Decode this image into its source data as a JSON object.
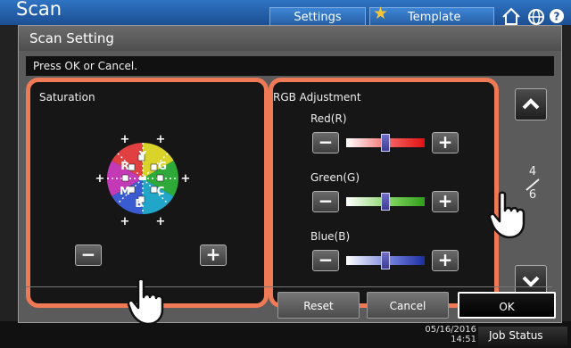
{
  "app": {
    "title": "Scan",
    "settings_label": "Settings",
    "template_label": "Template",
    "datetime_date": "05/16/2016",
    "datetime_time": "14:51",
    "job_status_label": "Job Status"
  },
  "dialog": {
    "title": "Scan Setting",
    "message": "Press OK or Cancel.",
    "saturation_label": "Saturation",
    "wheel_letters": [
      "Y",
      "R",
      "G",
      "M",
      "C",
      "B"
    ],
    "rgb_label": "RGB Adjustment",
    "sliders": [
      {
        "name": "Red(R)",
        "level": 0.5
      },
      {
        "name": "Green(G)",
        "level": 0.5
      },
      {
        "name": "Blue(B)",
        "level": 0.5
      }
    ],
    "page_current": "4",
    "page_total": "6",
    "buttons": {
      "reset": "Reset",
      "cancel": "Cancel",
      "ok": "OK"
    }
  },
  "colors": {
    "panel_outline": "#ef7a55",
    "title_bar": "#2f73c2"
  }
}
